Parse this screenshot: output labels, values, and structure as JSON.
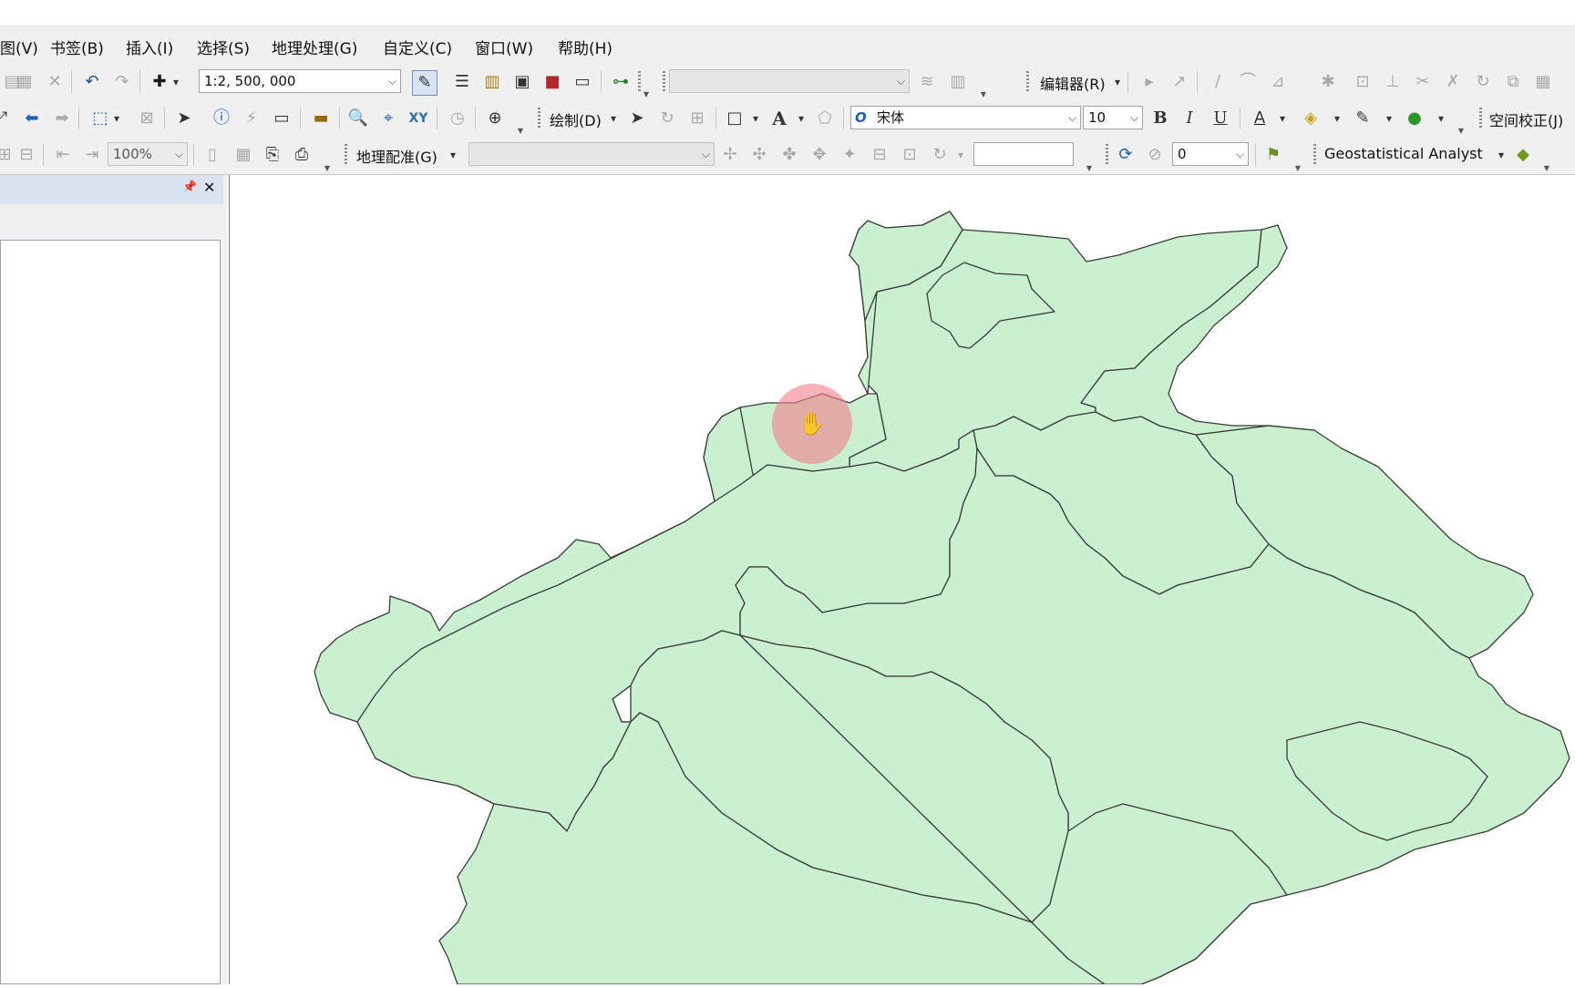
{
  "menu": [
    "图(V)",
    "书签(B)",
    "插入(I)",
    "选择(S)",
    "地理处理(G)",
    "自定义(C)",
    "窗口(W)",
    "帮助(H)"
  ],
  "standard_toolbar": {
    "scale_value": "1:2, 500, 000"
  },
  "editor_toolbar": {
    "editor_label": "编辑器(R)",
    "layer_combo": ""
  },
  "draw_toolbar": {
    "draw_label": "绘制(D)",
    "font_name": "宋体",
    "font_size": "10",
    "bold": "B",
    "italic": "I",
    "underline": "U",
    "text_tool": "A"
  },
  "spatial_adjust": {
    "label": "空间校正(J)"
  },
  "layout_toolbar": {
    "zoom_percent": "100%"
  },
  "georef_toolbar": {
    "label": "地理配准(G)",
    "layer_combo": "",
    "rotate_field": ""
  },
  "cache_toolbar": {
    "value": "0"
  },
  "geostat": {
    "label": "Geostatistical Analyst"
  },
  "toc": {
    "pin_glyph": "📌",
    "close_glyph": "✕"
  },
  "map": {
    "region_fill": "#c9f0cf",
    "region_stroke": "#3a3a3a"
  },
  "cursor": {
    "icon": "hand-pan-icon",
    "glyph": "✋"
  },
  "icons": {
    "undo": "↶",
    "redo": "↷",
    "add_data": "✚",
    "select_arrow": "➤",
    "identify": "ⓘ",
    "find": "🔍",
    "back": "⬅",
    "forward": "➡",
    "flag": "⚑",
    "diamond": "◆",
    "caret": "▾"
  }
}
